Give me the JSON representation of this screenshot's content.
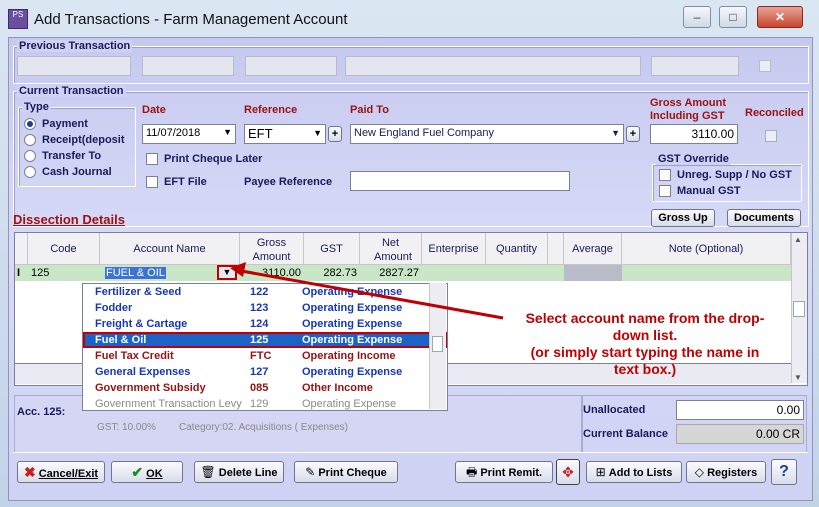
{
  "window": {
    "title": "Add Transactions - Farm Management Account",
    "icon_text": "PS",
    "controls": [
      "–",
      "□",
      "✕"
    ]
  },
  "previous": {
    "title": "Previous Transaction"
  },
  "current": {
    "title": "Current Transaction",
    "type_title": "Type",
    "types": [
      "Payment",
      "Receipt(deposit",
      "Transfer To",
      "Cash Journal"
    ],
    "date_label": "Date",
    "date_value": "11/07/2018",
    "reference_label": "Reference",
    "reference_value": "EFT",
    "paid_to_label": "Paid To",
    "paid_to_value": "New England Fuel Company",
    "gross_label_1": "Gross Amount",
    "gross_label_2": "Including GST",
    "gross_value": "3110.00",
    "reconciled_label": "Reconciled",
    "print_cheque_later": "Print Cheque Later",
    "eft_file": "EFT File",
    "payee_reference_label": "Payee Reference",
    "gst_override_title": "GST Override",
    "unreg_supp": "Unreg. Supp / No GST",
    "manual_gst": "Manual GST",
    "gross_up_button": "Gross Up",
    "documents_button": "Documents",
    "plus": "+"
  },
  "dissection": {
    "title": "Dissection Details",
    "headers": [
      "Code",
      "Account Name",
      "Gross Amount",
      "GST",
      "Net Amount",
      "Enterprise",
      "Quantity",
      "Average",
      "Note (Optional)"
    ],
    "row": {
      "marker": "I",
      "code": "125",
      "account": "FUEL & OIL",
      "gross": "3110.00",
      "gst": "282.73",
      "net": "2827.27"
    }
  },
  "dropdown": [
    {
      "name": "Fertilizer & Seed",
      "code": "122",
      "type": "Operating Expense",
      "style": "blue"
    },
    {
      "name": "Fodder",
      "code": "123",
      "type": "Operating Expense",
      "style": "blue"
    },
    {
      "name": "Freight & Cartage",
      "code": "124",
      "type": "Operating Expense",
      "style": "blue"
    },
    {
      "name": "Fuel & Oil",
      "code": "125",
      "type": "Operating Expense",
      "style": "selected"
    },
    {
      "name": "Fuel Tax Credit",
      "code": "FTC",
      "type": "Operating Income",
      "style": "red"
    },
    {
      "name": "General Expenses",
      "code": "127",
      "type": "Operating Expense",
      "style": "blue"
    },
    {
      "name": "Government Subsidy",
      "code": "085",
      "type": "Other Income",
      "style": "red"
    },
    {
      "name": "Government Transaction Levy",
      "code": "129",
      "type": "Operating Expense",
      "style": "grey"
    }
  ],
  "annotation": {
    "line1": "Select account name from the drop-",
    "line2": "down list.",
    "line3": "(or simply start typing the name in",
    "line4": "text box.)"
  },
  "account_info": {
    "acc": "Acc. 125:",
    "gst": "GST: 10.00%",
    "category": "Category:02. Acquisitions ( Expenses)"
  },
  "totals": {
    "unallocated_label": "Unallocated",
    "unallocated_value": "0.00",
    "current_balance_label": "Current Balance",
    "current_balance_value": "0.00 CR"
  },
  "toolbar": {
    "cancel": "Cancel/Exit",
    "ok": "OK",
    "delete_line": "Delete Line",
    "print_cheque": "Print Cheque",
    "print_remit": "Print Remit.",
    "add_to_lists": "Add to Lists",
    "registers": "Registers",
    "help": "?"
  },
  "colors": {
    "accent_red": "#c00000",
    "selected_blue": "#1c63c8",
    "row_green": "#c9e7c6"
  }
}
